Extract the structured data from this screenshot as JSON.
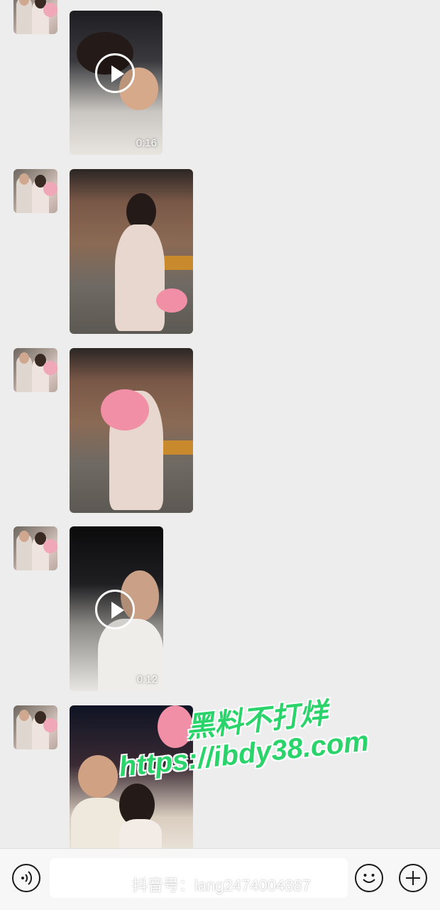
{
  "feed": {
    "messages": [
      {
        "type": "video",
        "duration": "0:16"
      },
      {
        "type": "photo"
      },
      {
        "type": "photo"
      },
      {
        "type": "video",
        "duration": "0:12"
      },
      {
        "type": "photo"
      }
    ]
  },
  "overlay": {
    "watermark_line1": "黑料不打烊",
    "watermark_line2": "https://ibdy38.com",
    "douyin_id": "抖音号：lang2474004887"
  },
  "icons": {
    "voice": "voice-icon",
    "emoji": "emoji-icon",
    "more": "plus-icon",
    "douyin": "douyin-logo-icon"
  },
  "colors": {
    "background": "#ededed",
    "watermark_green": "#2ad46a",
    "bottom_bar": "#f7f7f7"
  }
}
